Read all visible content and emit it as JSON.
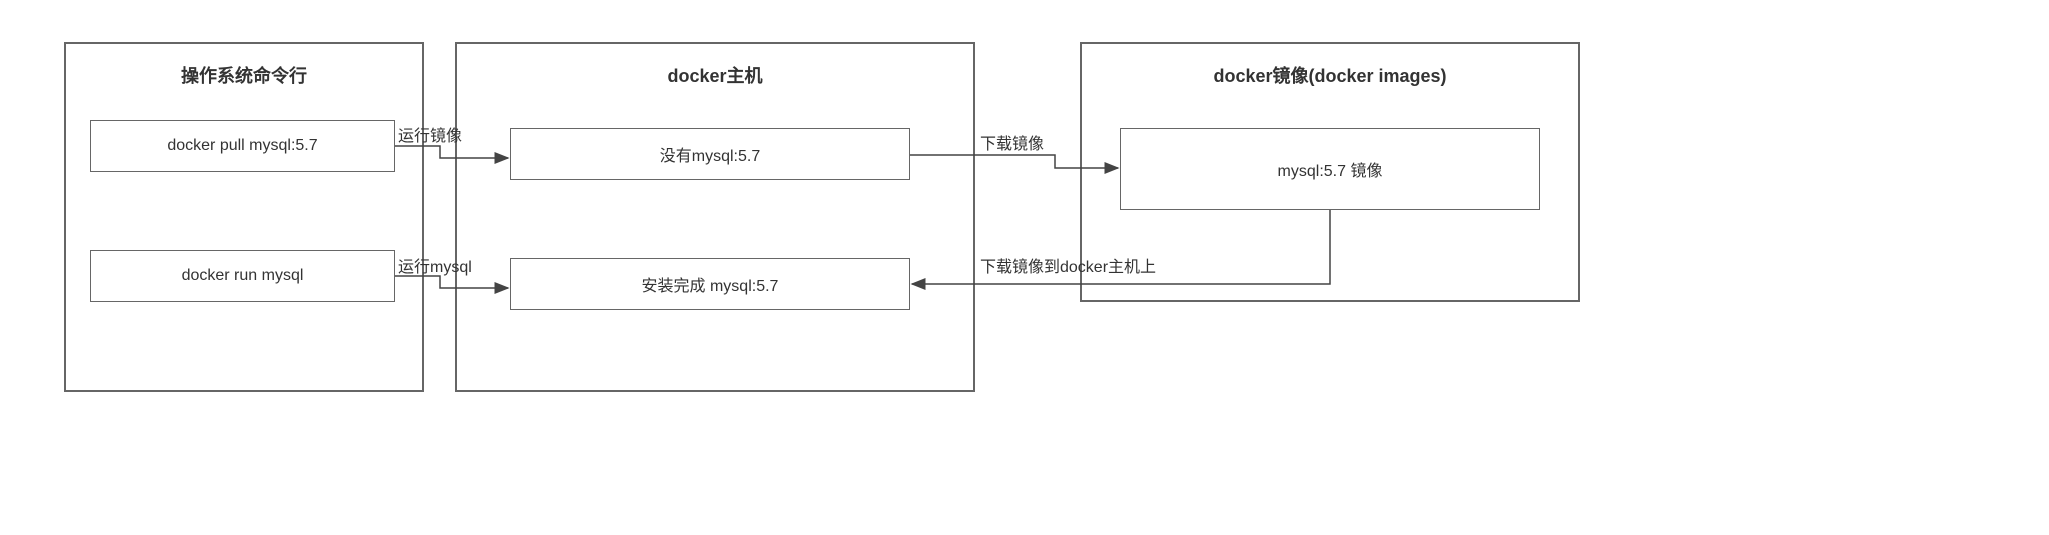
{
  "containers": {
    "left": {
      "title": "操作系统命令行",
      "box1": "docker pull  mysql:5.7",
      "box2": "docker run mysql"
    },
    "middle": {
      "title": "docker主机",
      "box1": "没有mysql:5.7",
      "box2": "安装完成 mysql:5.7"
    },
    "right": {
      "title": "docker镜像(docker images)",
      "box1": "mysql:5.7 镜像"
    }
  },
  "labels": {
    "run_image": "运行镜像",
    "download_image": "下载镜像",
    "run_mysql": "运行mysql",
    "download_to_host": "下载镜像到docker主机上"
  }
}
